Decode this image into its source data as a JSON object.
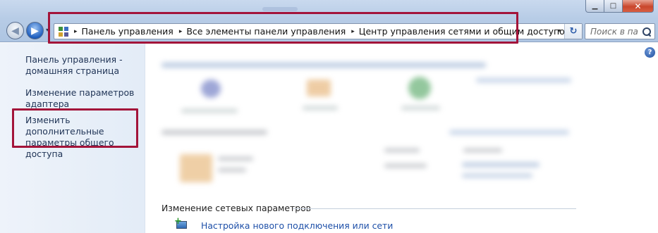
{
  "window": {
    "caption_buttons": {
      "minimize": "▁",
      "maximize": "□",
      "close": "✕"
    }
  },
  "address_bar": {
    "breadcrumbs": [
      "Панель управления",
      "Все элементы панели управления",
      "Центр управления сетями и общим доступом"
    ],
    "separator": "▸",
    "dropdown": "▾",
    "refresh": "↻"
  },
  "search": {
    "placeholder": "Поиск в па..."
  },
  "sidebar": {
    "items": [
      {
        "label": "Панель управления - домашняя страница"
      },
      {
        "label": "Изменение параметров адаптера"
      },
      {
        "label": "Изменить дополнительные параметры общего доступа"
      }
    ]
  },
  "main": {
    "help": "?",
    "section_title": "Изменение сетевых параметров",
    "setup_link": "Настройка нового подключения или сети"
  },
  "colors": {
    "highlight": "#a3143a",
    "link": "#1d4fa8",
    "sidebar_bg": "#e3ecf7"
  }
}
